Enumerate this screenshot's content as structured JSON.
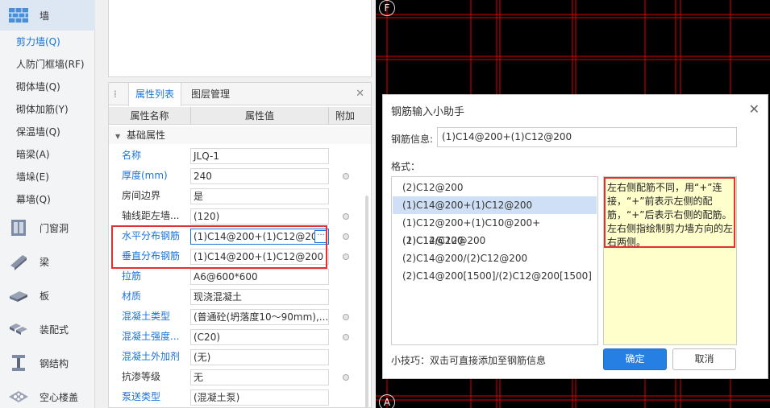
{
  "sidebar": {
    "wall_category": "墙",
    "wall_items": [
      "剪力墙(Q)",
      "人防门框墙(RF)",
      "砌体墙(Q)",
      "砌体加筋(Y)",
      "保温墙(Q)",
      "暗梁(A)",
      "墙垛(E)",
      "幕墙(Q)"
    ],
    "categories": [
      "门窗洞",
      "梁",
      "板",
      "装配式",
      "钢结构",
      "空心楼盖"
    ]
  },
  "property_panel": {
    "tabs": [
      "属性列表",
      "图层管理"
    ],
    "columns": [
      "属性名称",
      "属性值",
      "附加"
    ],
    "group": "基础属性",
    "rows": [
      {
        "name": "名称",
        "value": "JLQ-1"
      },
      {
        "name": "厚度(mm)",
        "value": "240"
      },
      {
        "name": "房间边界",
        "value": "是"
      },
      {
        "name": "轴线距左墙...",
        "value": "(120)"
      },
      {
        "name": "水平分布钢筋",
        "value": "(1)C14@200+(1)C12@200"
      },
      {
        "name": "垂直分布钢筋",
        "value": "(1)C14@200+(1)C12@200"
      },
      {
        "name": "拉筋",
        "value": "A6@600*600"
      },
      {
        "name": "材质",
        "value": "现浇混凝土"
      },
      {
        "name": "混凝土类型",
        "value": "(普通砼(坍落度10～90mm),..."
      },
      {
        "name": "混凝土强度...",
        "value": "(C20)"
      },
      {
        "name": "混凝土外加剂",
        "value": "(无)"
      },
      {
        "name": "抗渗等级",
        "value": "无"
      },
      {
        "name": "泵送类型",
        "value": "(混凝土泵)"
      }
    ]
  },
  "canvas": {
    "axis_top": "F",
    "axis_bottom": "A"
  },
  "dialog": {
    "title": "钢筋输入小助手",
    "info_label": "钢筋信息:",
    "info_value": "(1)C14@200+(1)C12@200",
    "format_label": "格式：",
    "formats": [
      "(2)C12@200",
      "(1)C14@200+(1)C12@200",
      "(1)C12@200+(1)C10@200+(1)C12@200",
      "(2)C14/C12@200",
      "(2)C14@200/(2)C12@200",
      "(2)C14@200[1500]/(2)C12@200[1500]"
    ],
    "tip": "左右侧配筋不同，用“+”连接，“+”前表示左侧的配筋，“+”后表示右侧的配筋。左右侧指绘制剪力墙方向的左右两侧。",
    "hint": "小技巧：双击可直接添加至钢筋信息",
    "ok": "确定",
    "cancel": "取消"
  },
  "colors": {
    "accent": "#1a73d9",
    "highlight_border": "#e03232",
    "tip_background": "#ffffcc",
    "selection": "#cfe0f6",
    "cad_grid": "#e00000"
  }
}
